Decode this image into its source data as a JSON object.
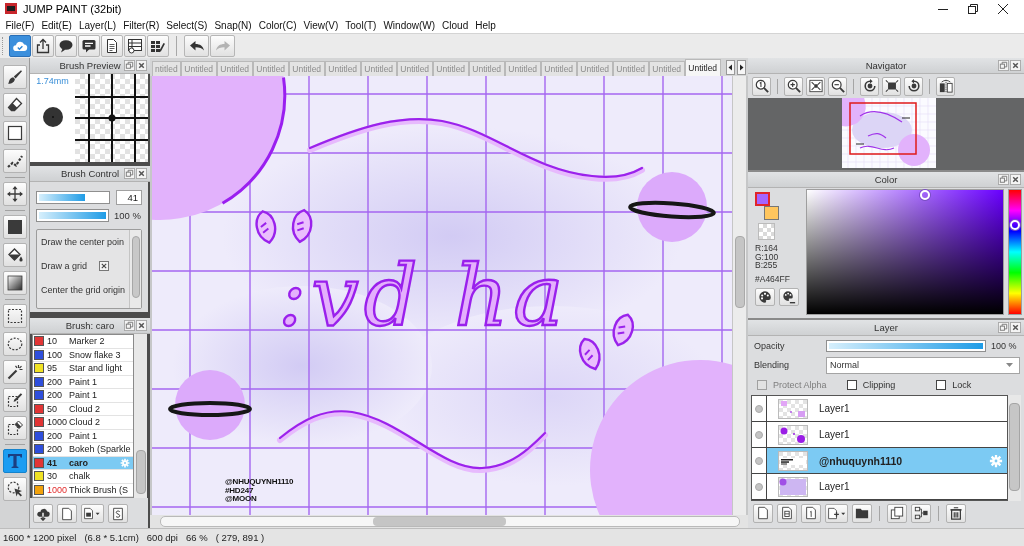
{
  "window": {
    "title": "JUMP PAINT (32bit)"
  },
  "menu": [
    "File(F)",
    "Edit(E)",
    "Layer(L)",
    "Filter(R)",
    "Select(S)",
    "Snap(N)",
    "Color(C)",
    "View(V)",
    "Tool(T)",
    "Window(W)",
    "Cloud",
    "Help"
  ],
  "toolbar": [
    {
      "selected": true,
      "disabled": false
    },
    {
      "selected": false,
      "disabled": false
    },
    {
      "selected": false,
      "disabled": false
    },
    {
      "selected": false,
      "disabled": false
    },
    {
      "selected": false,
      "disabled": false
    },
    {
      "selected": false,
      "disabled": false
    },
    {
      "selected": false,
      "disabled": false
    },
    {
      "selected": false,
      "disabled": false
    },
    {
      "selected": false,
      "disabled": true
    }
  ],
  "tools": [
    {
      "selected": false
    },
    {
      "selected": false
    },
    {
      "selected": false
    },
    {
      "selected": false
    },
    {
      "selected": false
    },
    {
      "selected": false
    },
    {
      "selected": false
    },
    {
      "selected": false
    },
    {
      "selected": false
    },
    {
      "selected": false
    },
    {
      "selected": false
    },
    {
      "selected": false
    },
    {
      "selected": false
    },
    {
      "selected": true
    },
    {
      "selected": false
    }
  ],
  "brush_preview": {
    "title": "Brush Preview",
    "size": "1.74mm"
  },
  "brush_control": {
    "title": "Brush Control",
    "size": {
      "level": 0.67,
      "value": "41"
    },
    "opacity": {
      "level": 1,
      "reading": "100 %"
    },
    "options": [
      {
        "kind": "text",
        "label": "Draw the center poin"
      },
      {
        "kind": "checkbox",
        "label": "Draw a grid",
        "checked": true
      },
      {
        "kind": "text",
        "label": "Center the grid origin"
      }
    ]
  },
  "brush_list": {
    "title": "Brush: caro",
    "items": [
      {
        "color": "#e23636",
        "size": "10",
        "name": "Marker 2",
        "selected": false,
        "alert": false
      },
      {
        "color": "#2f4fdc",
        "size": "100",
        "name": "Snow flake 3",
        "selected": false,
        "alert": false
      },
      {
        "color": "#f0e224",
        "size": "95",
        "name": "Star and light",
        "selected": false,
        "alert": false
      },
      {
        "color": "#2f4fdc",
        "size": "200",
        "name": "Paint 1",
        "selected": false,
        "alert": false
      },
      {
        "color": "#2f4fdc",
        "size": "200",
        "name": "Paint 1",
        "selected": false,
        "alert": false
      },
      {
        "color": "#e23636",
        "size": "50",
        "name": "Cloud 2",
        "selected": false,
        "alert": false
      },
      {
        "color": "#e23636",
        "size": "1000",
        "name": "Cloud 2",
        "selected": false,
        "alert": false
      },
      {
        "color": "#2f4fdc",
        "size": "200",
        "name": "Paint 1",
        "selected": false,
        "alert": false
      },
      {
        "color": "#2f4fdc",
        "size": "200",
        "name": "Bokeh (Sparkle",
        "selected": false,
        "alert": false
      },
      {
        "color": "#e23636",
        "size": "41",
        "name": "caro",
        "selected": true,
        "alert": false
      },
      {
        "color": "#f0e224",
        "size": "30",
        "name": "chalk",
        "selected": false,
        "alert": false
      },
      {
        "color": "#f2a20c",
        "size": "1000",
        "name": "Thick Brush (S",
        "selected": false,
        "alert": true
      }
    ]
  },
  "tabs": [
    {
      "label": "ntitled",
      "selected": false
    },
    {
      "label": "Untitled",
      "selected": false
    },
    {
      "label": "Untitled",
      "selected": false
    },
    {
      "label": "Untitled",
      "selected": false
    },
    {
      "label": "Untitled",
      "selected": false
    },
    {
      "label": "Untitled",
      "selected": false
    },
    {
      "label": "Untitled",
      "selected": false
    },
    {
      "label": "Untitled",
      "selected": false
    },
    {
      "label": "Untitled",
      "selected": false
    },
    {
      "label": "Untitled",
      "selected": false
    },
    {
      "label": "Untitled",
      "selected": false
    },
    {
      "label": "Untitled",
      "selected": false
    },
    {
      "label": "Untitled",
      "selected": false
    },
    {
      "label": "Untitled",
      "selected": false
    },
    {
      "label": "Untitled",
      "selected": false
    },
    {
      "label": "Untitled",
      "selected": true
    }
  ],
  "canvas": {
    "lettering": ":vd ha",
    "credits": [
      "@NHUQUYNH1110",
      "#HD247",
      "@MOON"
    ]
  },
  "navigator": {
    "title": "Navigator"
  },
  "color": {
    "title": "Color",
    "swatches": [
      {
        "kind": "foreground",
        "color": "#a464ff",
        "selected": true
      },
      {
        "kind": "background",
        "color": "#ffc65e",
        "selected": false
      }
    ],
    "rgb": [
      "R:164",
      "G:100",
      "B:255"
    ],
    "hex": "#A464FF"
  },
  "layer": {
    "title": "Layer",
    "opacity": {
      "label": "Opacity",
      "level": 1,
      "reading": "100 %"
    },
    "blending": {
      "label": "Blending",
      "value": "Normal"
    },
    "options": [
      {
        "label": "Protect Alpha",
        "checked": false,
        "disabled": true
      },
      {
        "label": "Clipping",
        "checked": false,
        "disabled": false
      },
      {
        "label": "Lock",
        "checked": false,
        "disabled": false
      }
    ],
    "layers": [
      {
        "name": "Layer1",
        "selected": false
      },
      {
        "name": "Layer1",
        "selected": false
      },
      {
        "name": "@nhuquynh1110",
        "selected": true
      },
      {
        "name": "Layer1",
        "selected": false
      }
    ]
  },
  "status_bar": [
    "1600 * 1200 pixel",
    "(6.8 * 5.1cm)",
    "600 dpi",
    "66 %",
    "( 279, 891 )"
  ]
}
